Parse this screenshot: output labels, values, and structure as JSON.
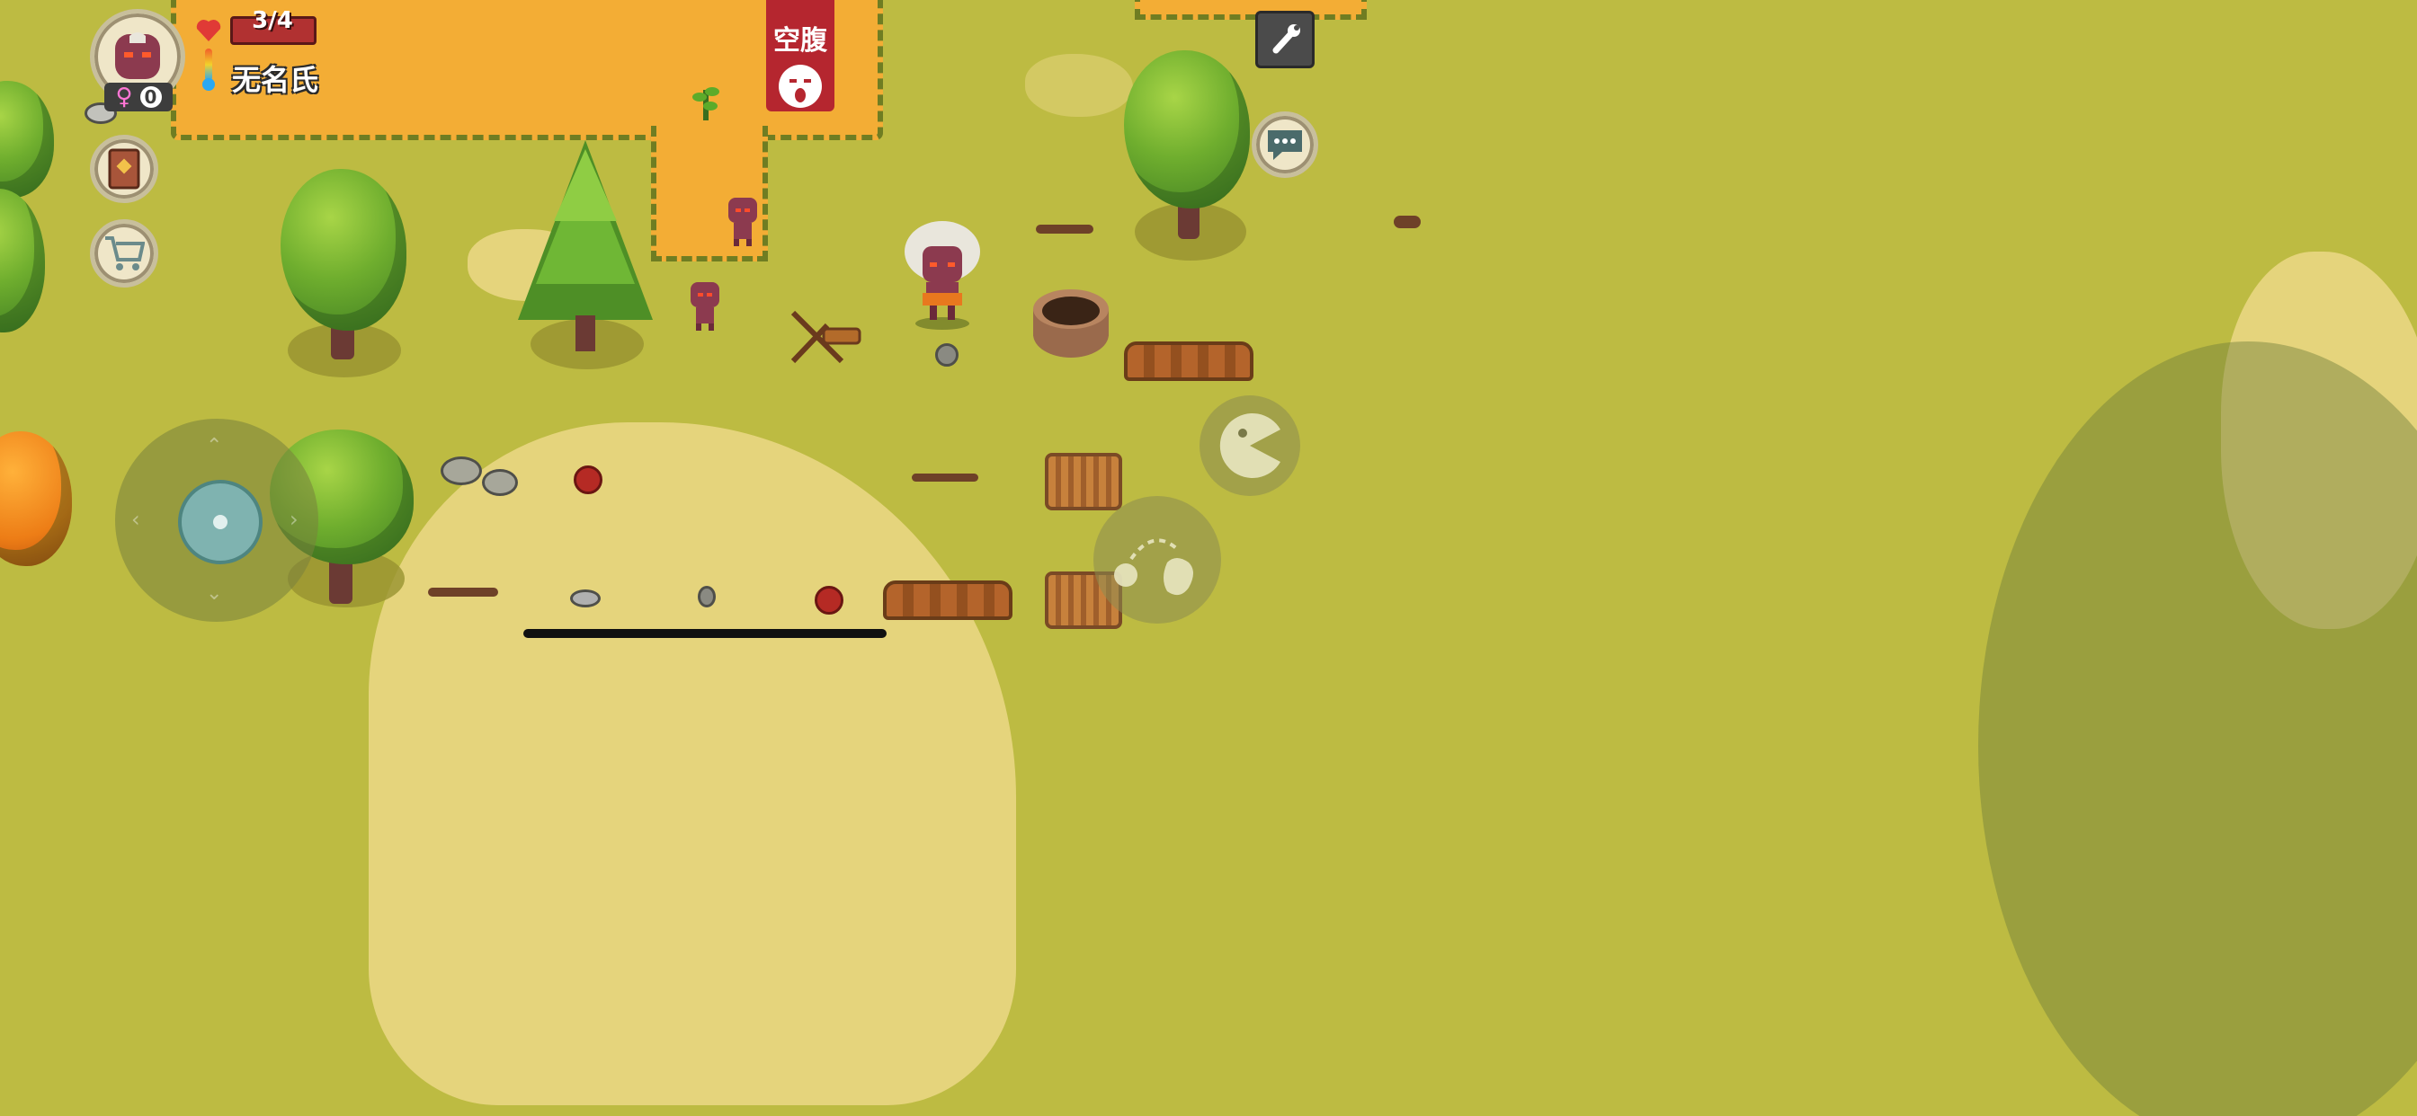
{
  "player": {
    "health_text": "3/4",
    "name": "无名氏",
    "gender_symbol": "♀",
    "children_count": "0"
  },
  "status_banner": {
    "label": "空腹"
  },
  "icons": {
    "avatar": "player-avatar-icon",
    "heart": "heart-icon",
    "thermometer": "thermometer-icon",
    "recipe_book": "recipe-book-icon",
    "shop_cart": "shop-cart-icon",
    "settings_wrench": "wrench-icon",
    "chat": "chat-bubble-icon",
    "eat": "eat-icon",
    "throw": "throw-icon",
    "hunger_face": "hungry-face-icon"
  },
  "colors": {
    "field": "#f3ad35",
    "grass": "#bdbb42",
    "banner_red": "#b5262f",
    "health_bar": "#b13131"
  }
}
